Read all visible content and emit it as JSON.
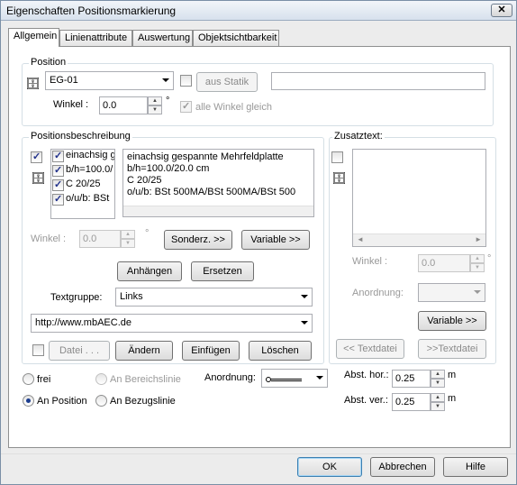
{
  "window": {
    "title": "Eigenschaften Positionsmarkierung",
    "close_glyph": "✕"
  },
  "tabs": [
    {
      "label": "Allgemein"
    },
    {
      "label": "Linienattribute"
    },
    {
      "label": "Auswertung"
    },
    {
      "label": "Objektsichtbarkeit"
    }
  ],
  "position": {
    "group_label": "Position",
    "name_value": "EG-01",
    "aus_statik_label": "aus Statik",
    "extra_text": "",
    "winkel_label": "Winkel :",
    "winkel_value": "0.0",
    "winkel_unit": "°",
    "alle_winkel_label": "alle Winkel gleich"
  },
  "beschreibung": {
    "group_label": "Positionsbeschreibung",
    "list_items": [
      {
        "label": "einachsig g",
        "checked": true
      },
      {
        "label": "b/h=100.0/",
        "checked": true
      },
      {
        "label": "C 20/25",
        "checked": true
      },
      {
        "label": "o/u/b: BSt",
        "checked": true
      }
    ],
    "text_lines": [
      "einachsig gespannte Mehrfeldplatte",
      "b/h=100.0/20.0 cm",
      "C 20/25",
      "o/u/b: BSt 500MA/BSt 500MA/BSt 500"
    ],
    "winkel_label": "Winkel :",
    "winkel_value": "0.0",
    "winkel_unit": "°",
    "sonderz_label": "Sonderz. >>",
    "variable_label": "Variable >>",
    "anhaengen_label": "Anhängen",
    "ersetzen_label": "Ersetzen",
    "textgruppe_label": "Textgruppe:",
    "textgruppe_value": "Links",
    "url_value": "http://www.mbAEC.de",
    "datei_label": "Datei . . .",
    "aendern_label": "Ändern",
    "einfuegen_label": "Einfügen",
    "loeschen_label": "Löschen"
  },
  "zusatztext": {
    "group_label": "Zusatztext:",
    "winkel_label": "Winkel :",
    "winkel_value": "0.0",
    "winkel_unit": "°",
    "anordnung_label": "Anordnung:",
    "variable_label": "Variable >>",
    "textdatei_prev": "<< Textdatei",
    "textdatei_next": ">>Textdatei"
  },
  "bottom": {
    "frei_label": "frei",
    "an_bereichslinie_label": "An Bereichslinie",
    "an_position_label": "An Position",
    "an_bezugslinie_label": "An Bezugslinie",
    "anordnung_label": "Anordnung:",
    "abst_hor_label": "Abst. hor.:",
    "abst_hor_value": "0.25",
    "abst_ver_label": "Abst. ver.:",
    "abst_ver_value": "0.25",
    "unit": "m"
  },
  "footer": {
    "ok_label": "OK",
    "abbrechen_label": "Abbrechen",
    "hilfe_label": "Hilfe"
  },
  "icons": {
    "cabinet": "🗄",
    "arrow_up": "▲",
    "arrow_down": "▼",
    "arrow_left": "◄",
    "arrow_right": "►"
  }
}
